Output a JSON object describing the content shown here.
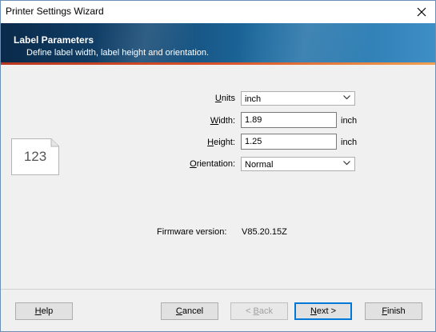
{
  "window": {
    "title": "Printer Settings Wizard"
  },
  "banner": {
    "title": "Label Parameters",
    "subtitle": "Define label width, label height and orientation."
  },
  "label_icon": {
    "text": "123"
  },
  "form": {
    "units": {
      "label_acc": "U",
      "label_rest": "nits",
      "value": "inch",
      "options": [
        "inch"
      ]
    },
    "width": {
      "label_acc": "W",
      "label_rest": "idth:",
      "value": "1.89",
      "unit": "inch"
    },
    "height": {
      "label_acc": "H",
      "label_rest": "eight:",
      "value": "1.25",
      "unit": "inch"
    },
    "orientation": {
      "label_acc": "O",
      "label_rest": "rientation:",
      "value": "Normal",
      "options": [
        "Normal"
      ]
    }
  },
  "firmware": {
    "label": "Firmware version:",
    "value": "V85.20.15Z"
  },
  "buttons": {
    "help": {
      "acc": "H",
      "rest": "elp"
    },
    "cancel": {
      "acc": "C",
      "rest": "ancel"
    },
    "back": {
      "pre": "< ",
      "acc": "B",
      "rest": "ack"
    },
    "next": {
      "acc": "N",
      "rest": "ext >"
    },
    "finish": {
      "acc": "F",
      "rest": "inish"
    }
  }
}
